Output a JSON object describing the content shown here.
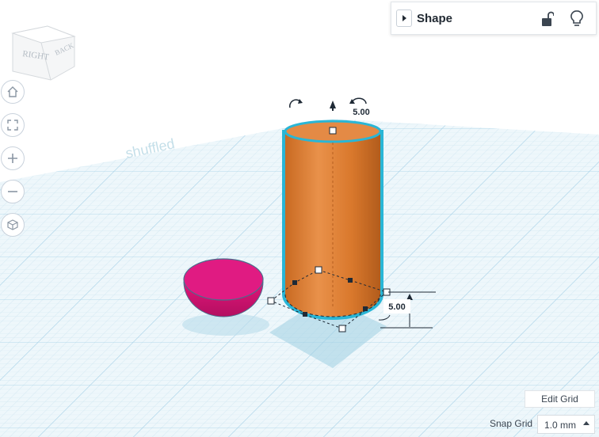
{
  "view_cube": {
    "faces": [
      "RIGHT",
      "BACK"
    ]
  },
  "nav_controls": [
    "home-icon",
    "fit-view-icon",
    "zoom-in-icon",
    "zoom-out-icon",
    "orthographic-icon"
  ],
  "shape_panel": {
    "title": "Shape",
    "icons": [
      "chevron-right-icon",
      "unlock-icon",
      "lightbulb-icon"
    ]
  },
  "dimensions": {
    "height": "5.00",
    "elevation": "5.00"
  },
  "workplane": {
    "colors": {
      "grid": "#cfe6f1",
      "grid_major": "#a9d3e8",
      "selection": "#29b6d6"
    }
  },
  "shapes": [
    {
      "name": "cylinder",
      "color": "#e38a3b"
    },
    {
      "name": "half-sphere",
      "color": "#e0157a"
    }
  ],
  "bottom": {
    "edit_grid": "Edit Grid",
    "snap_label": "Snap Grid",
    "snap_value": "1.0 mm"
  }
}
